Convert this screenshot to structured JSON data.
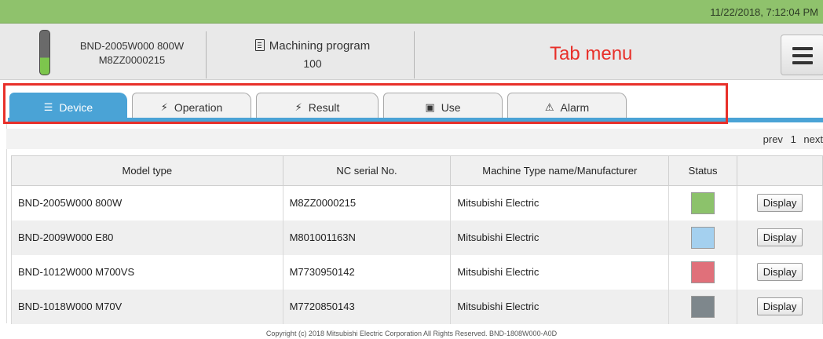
{
  "topbar": {
    "datetime": "11/22/2018, 7:12:04 PM"
  },
  "header": {
    "machine_line1": "BND-2005W000 800W",
    "machine_line2": "M8ZZ0000215",
    "program_label": "Machining program",
    "program_number": "100",
    "annotation": "Tab menu",
    "menu_icon": "hamburger-menu-icon"
  },
  "tabs": [
    {
      "label": "Device",
      "icon": "list-icon",
      "active": true
    },
    {
      "label": "Operation",
      "icon": "lightning-icon",
      "active": false
    },
    {
      "label": "Result",
      "icon": "lightning-icon",
      "active": false
    },
    {
      "label": "Use",
      "icon": "battery-icon",
      "active": false
    },
    {
      "label": "Alarm",
      "icon": "warning-icon",
      "active": false
    }
  ],
  "pager": {
    "prev": "prev",
    "page": "1",
    "next": "next"
  },
  "table": {
    "headers": [
      "Model type",
      "NC serial No.",
      "Machine Type name/Manufacturer",
      "Status",
      ""
    ],
    "rows": [
      {
        "model": "BND-2005W000 800W",
        "serial": "M8ZZ0000215",
        "manufacturer": "Mitsubishi Electric",
        "status_color": "#8cc26b",
        "action": "Display"
      },
      {
        "model": "BND-2009W000 E80",
        "serial": "M801001163N",
        "manufacturer": "Mitsubishi Electric",
        "status_color": "#a4d0ef",
        "action": "Display"
      },
      {
        "model": "BND-1012W000 M700VS",
        "serial": "M7730950142",
        "manufacturer": "Mitsubishi Electric",
        "status_color": "#e0707a",
        "action": "Display"
      },
      {
        "model": "BND-1018W000 M70V",
        "serial": "M7720850143",
        "manufacturer": "Mitsubishi Electric",
        "status_color": "#7e878c",
        "action": "Display"
      }
    ]
  },
  "footer": "Copyright (c) 2018 Mitsubishi Electric Corporation All Rights Reserved. BND-1808W000-A0D",
  "colors": {
    "topbar": "#8fc26c",
    "tab_active": "#4aa3d6",
    "annotation": "#e8302a"
  }
}
